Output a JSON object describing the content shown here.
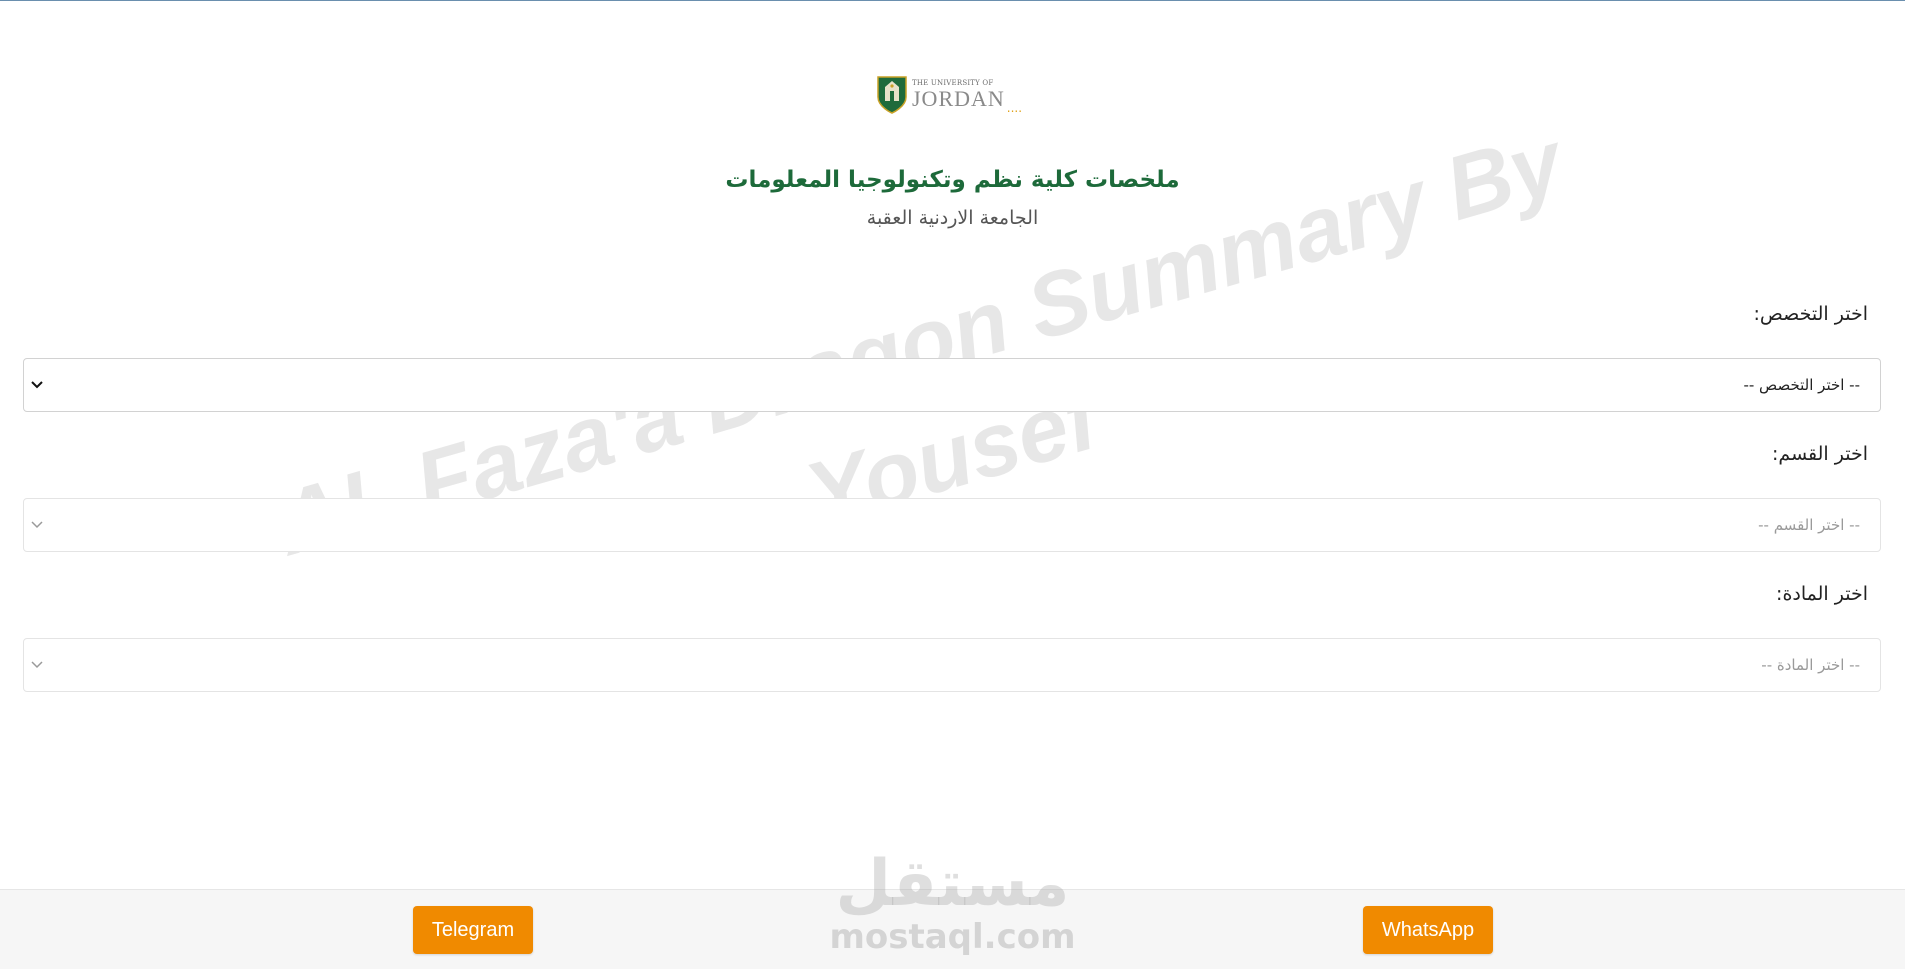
{
  "logo": {
    "small_text": "THE UNIVERSITY OF",
    "big_text": "JORDAN",
    "dots": "....",
    "icon": "university-seal-icon"
  },
  "header": {
    "title": "ملخصات كلية نظم وتكنولوجيا المعلومات",
    "subtitle": "الجامعة الاردنية العقبة"
  },
  "watermark": {
    "text": "AL Faza'a Dragon Summary By Yousef"
  },
  "form": {
    "specialization": {
      "label": "اختر التخصص:",
      "selected": "-- اختر التخصص --"
    },
    "department": {
      "label": "اختر القسم:",
      "selected": "-- اختر القسم --"
    },
    "subject": {
      "label": "اختر المادة:",
      "selected": "-- اختر المادة --"
    }
  },
  "footer": {
    "telegram_label": "Telegram",
    "whatsapp_label": "WhatsApp",
    "button_color": "#f08a00"
  },
  "site_watermark": {
    "arabic": "مستقل",
    "latin": "mostaql.com"
  },
  "colors": {
    "title_green": "#1d6a3a",
    "accent_orange": "#f08a00"
  }
}
